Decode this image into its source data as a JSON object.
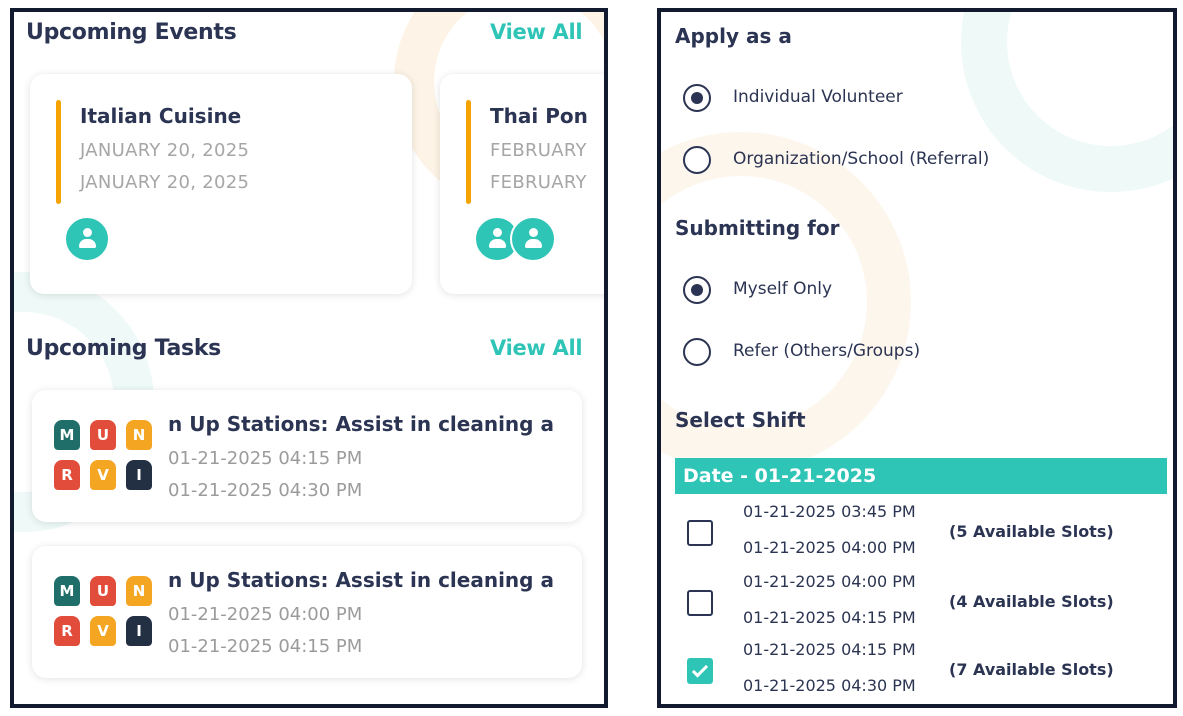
{
  "events_panel": {
    "events_title": "Upcoming Events",
    "events_view_all": "View All",
    "events": [
      {
        "title": "Italian Cuisine",
        "start": "JANUARY 20, 2025",
        "end": "JANUARY 20, 2025",
        "participant_icon": "user-icon"
      },
      {
        "title": "Thai Pon",
        "start": "FEBRUARY",
        "end": "FEBRUARY",
        "participant_icon": "user-icon"
      }
    ],
    "tasks_title": "Upcoming Tasks",
    "tasks_view_all": "View All",
    "tasks": [
      {
        "title": "n Up Stations: Assist in cleaning a",
        "start": "01-21-2025 04:15 PM",
        "end": "01-21-2025 04:30 PM"
      },
      {
        "title": "n Up Stations: Assist in cleaning a",
        "start": "01-21-2025 04:00 PM",
        "end": "01-21-2025 04:15 PM"
      }
    ],
    "task_logo_letters": [
      "M",
      "U",
      "N",
      "R",
      "V",
      "I"
    ]
  },
  "form_panel": {
    "apply_label": "Apply as a",
    "apply_options": [
      {
        "label": "Individual Volunteer",
        "selected": true
      },
      {
        "label": "Organization/School (Referral)",
        "selected": false
      }
    ],
    "submitting_label": "Submitting for",
    "submitting_options": [
      {
        "label": "Myself Only",
        "selected": true
      },
      {
        "label": "Refer (Others/Groups)",
        "selected": false
      }
    ],
    "shift_label": "Select Shift",
    "date_header": "Date - 01-21-2025",
    "shifts": [
      {
        "start": "01-21-2025 03:45 PM",
        "end": "01-21-2025 04:00 PM",
        "slots": "(5 Available Slots)",
        "checked": false
      },
      {
        "start": "01-21-2025 04:00 PM",
        "end": "01-21-2025 04:15 PM",
        "slots": "(4 Available Slots)",
        "checked": false
      },
      {
        "start": "01-21-2025 04:15 PM",
        "end": "01-21-2025 04:30 PM",
        "slots": "(7 Available Slots)",
        "checked": true
      }
    ]
  },
  "colors": {
    "accent_teal": "#2ec4b6",
    "accent_orange": "#f5a300",
    "text_dark": "#2b3452",
    "text_muted": "#a6a6a6",
    "panel_border": "#111a2e"
  }
}
